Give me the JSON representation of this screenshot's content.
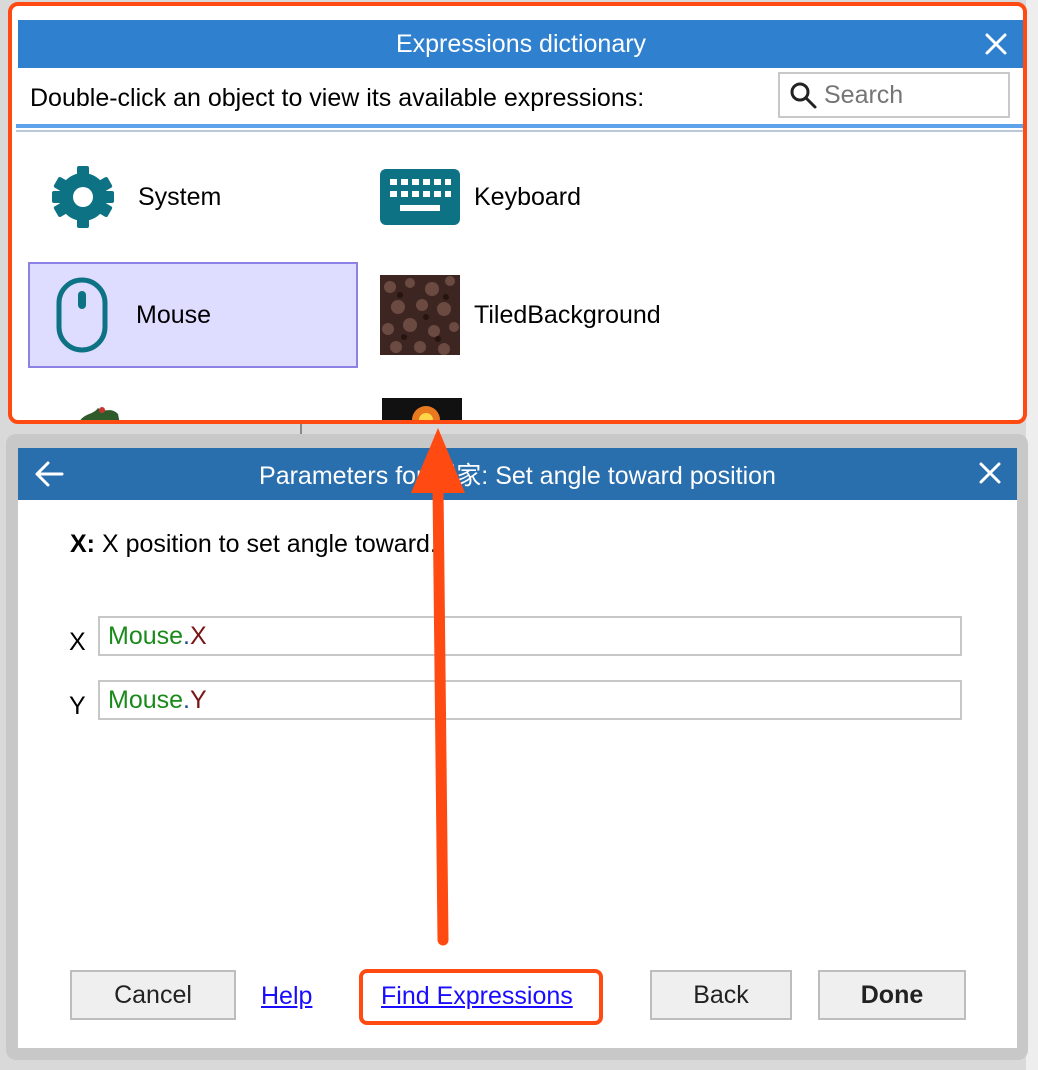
{
  "expressions_dialog": {
    "title": "Expressions dictionary",
    "instruction": "Double-click an object to view its available expressions:",
    "search_placeholder": "Search",
    "objects": [
      {
        "label": "System",
        "icon": "gear-icon"
      },
      {
        "label": "Keyboard",
        "icon": "keyboard-icon"
      },
      {
        "label": "Mouse",
        "icon": "mouse-icon",
        "selected": true
      },
      {
        "label": "TiledBackground",
        "icon": "tiled-background-thumbnail"
      }
    ]
  },
  "parameters_dialog": {
    "title": "Parameters for 玩家: Set angle toward position",
    "description_key": "X:",
    "description_text": " X position to set angle toward.",
    "params": [
      {
        "label": "X",
        "object": "Mouse",
        "dot": ".",
        "property": "X"
      },
      {
        "label": "Y",
        "object": "Mouse",
        "dot": ".",
        "property": "Y"
      }
    ],
    "buttons": {
      "cancel": "Cancel",
      "help": "Help",
      "find_expressions": "Find Expressions",
      "back": "Back",
      "done": "Done"
    }
  },
  "colors": {
    "annotation": "#ff4a12",
    "dict_titlebar": "#2f80cf",
    "param_titlebar": "#2a6fad",
    "icon_teal": "#0e7285"
  }
}
